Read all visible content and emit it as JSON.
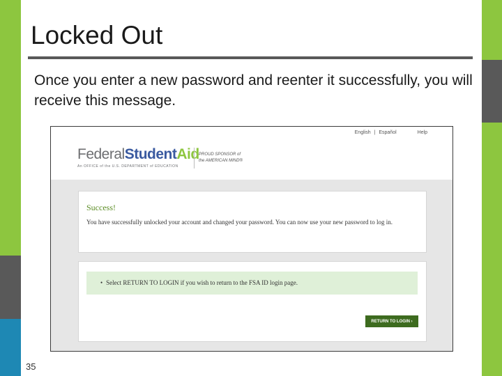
{
  "slide": {
    "title": "Locked Out",
    "body": "Once you enter a new password and reenter it successfully, you will receive this message.",
    "page_number": "35"
  },
  "screenshot": {
    "util_nav": {
      "english": "English",
      "separator": "|",
      "espanol": "Español",
      "help": "Help"
    },
    "logo": {
      "federal": "Federal",
      "student": "Student",
      "aid": "Aid",
      "subtitle": "An OFFICE of the U.S. DEPARTMENT of EDUCATION",
      "sponsor_line1": "PROUD SPONSOR of",
      "sponsor_line2": "the AMERICAN MIND®"
    },
    "success": {
      "title": "Success!",
      "message": "You have successfully unlocked your account and changed your password. You can now use your new password to log in."
    },
    "info": {
      "bullet": "•",
      "text": "Select RETURN TO LOGIN if you wish to return to the FSA ID login page."
    },
    "return_button_label": "RETURN TO LOGIN ›"
  },
  "colors": {
    "accent_green": "#8dc63f",
    "accent_gray": "#595959",
    "accent_blue": "#1e88b4",
    "fsa_blue": "#3a5aa0",
    "success_green": "#5a8b23",
    "info_bg": "#dff0d8",
    "button_green": "#3d6b1f"
  }
}
